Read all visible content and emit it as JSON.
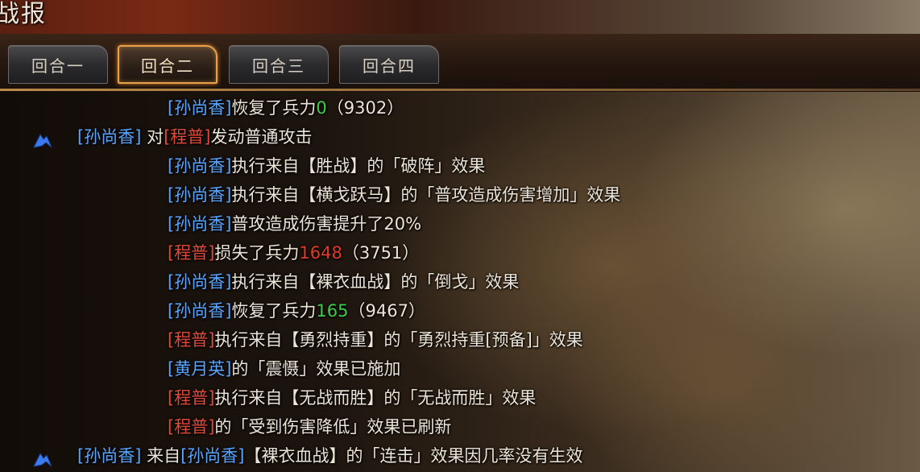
{
  "window": {
    "title": "战报"
  },
  "tabs": [
    {
      "label": "回合一",
      "active": false
    },
    {
      "label": "回合二",
      "active": true
    },
    {
      "label": "回合三",
      "active": false
    },
    {
      "label": "回合四",
      "active": false
    }
  ],
  "log": {
    "line1": {
      "a": "[孙尚香]",
      "b": "恢复了兵力",
      "c": "0",
      "d": "（9302）"
    },
    "line2": {
      "a": "[孙尚香]",
      "b": " 对",
      "c": "[程普]",
      "d": "发动普通攻击"
    },
    "line3": {
      "a": "[孙尚香]",
      "b": "执行来自【胜战】的「破阵」效果"
    },
    "line4": {
      "a": "[孙尚香]",
      "b": "执行来自【横戈跃马】的「普攻造成伤害增加」效果"
    },
    "line5": {
      "a": "[孙尚香]",
      "b": "普攻造成伤害提升了20%"
    },
    "line6": {
      "a": "[程普]",
      "b": "损失了兵力",
      "c": "1648",
      "d": "（3751）"
    },
    "line7": {
      "a": "[孙尚香]",
      "b": "执行来自【裸衣血战】的「倒戈」效果"
    },
    "line8": {
      "a": "[孙尚香]",
      "b": "恢复了兵力",
      "c": "165",
      "d": "（9467）"
    },
    "line9": {
      "a": "[程普]",
      "b": "执行来自【勇烈持重】的「勇烈持重[预备]」效果"
    },
    "line10": {
      "a": "[黄月英]",
      "b": "的「震慑」效果已施加"
    },
    "line11": {
      "a": "[程普]",
      "b": "执行来自【无战而胜】的「无战而胜」效果"
    },
    "line12": {
      "a": "[程普]",
      "b": "的「受到伤害降低」效果已刷新"
    },
    "line13": {
      "a": "[孙尚香]",
      "b": " 来自",
      "c": "[孙尚香]",
      "d": "【裸衣血战】的「连击」效果因几率没有生效"
    }
  },
  "colors": {
    "ally_name": "#5aa6ff",
    "enemy_name": "#e04a3a",
    "heal_number": "#3ecf4a",
    "damage_number": "#e23a2a",
    "text": "#ece4d6",
    "active_tab_border": "#e8a24a"
  },
  "icons": {
    "attack_marker": "blue-horse-icon"
  }
}
